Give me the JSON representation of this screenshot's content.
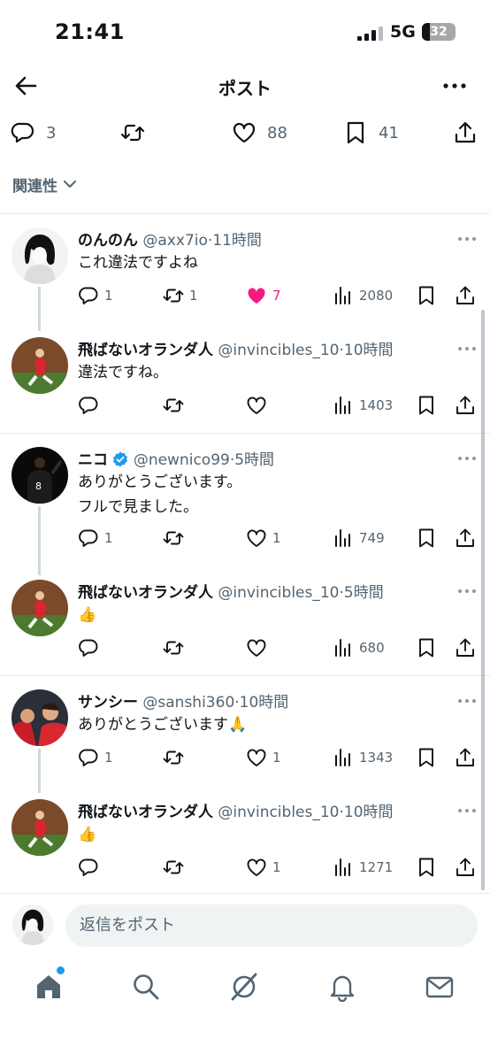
{
  "status_bar": {
    "time": "21:41",
    "network": "5G",
    "battery": "32"
  },
  "header": {
    "title": "ポスト",
    "back_icon": "arrow-left-icon",
    "more_icon": "more-horizontal-icon"
  },
  "main_post": {
    "replies": "3",
    "likes": "88",
    "bookmarks": "41"
  },
  "sort": {
    "label": "関連性"
  },
  "replies": [
    {
      "name": "のんのん",
      "handle": "@axx7io",
      "time": "11時間",
      "text": [
        "これ違法ですよね"
      ],
      "reply_count": "1",
      "repost_count": "1",
      "like_count": "7",
      "views": "2080",
      "liked": true
    },
    {
      "name": "飛ばないオランダ人",
      "handle": "@invincibles_10",
      "time": "10時間",
      "text": [
        "違法ですね。"
      ],
      "reply_count": "",
      "repost_count": "",
      "like_count": "",
      "views": "1403"
    },
    {
      "name": "ニコ",
      "handle": "@newnico99",
      "time": "5時間",
      "verified": true,
      "text": [
        "ありがとうございます。",
        "フルで見ました。"
      ],
      "reply_count": "1",
      "repost_count": "",
      "like_count": "1",
      "views": "749"
    },
    {
      "name": "飛ばないオランダ人",
      "handle": "@invincibles_10",
      "time": "5時間",
      "text": [
        "👍"
      ],
      "reply_count": "",
      "repost_count": "",
      "like_count": "",
      "views": "680"
    },
    {
      "name": "サンシー",
      "handle": "@sanshi360",
      "time": "10時間",
      "text": [
        "ありがとうございます🙏"
      ],
      "reply_count": "1",
      "repost_count": "",
      "like_count": "1",
      "views": "1343"
    },
    {
      "name": "飛ばないオランダ人",
      "handle": "@invincibles_10",
      "time": "10時間",
      "text": [
        "👍"
      ],
      "reply_count": "",
      "repost_count": "",
      "like_count": "1",
      "views": "1271"
    }
  ],
  "composer": {
    "placeholder": "返信をポスト"
  },
  "bottom_nav": [
    "home-icon",
    "search-icon",
    "grok-icon",
    "notifications-bell-icon",
    "messages-mail-icon"
  ],
  "colors": {
    "accent": "#1d9bf0",
    "like": "#f91880",
    "secondary_text": "#536471"
  }
}
